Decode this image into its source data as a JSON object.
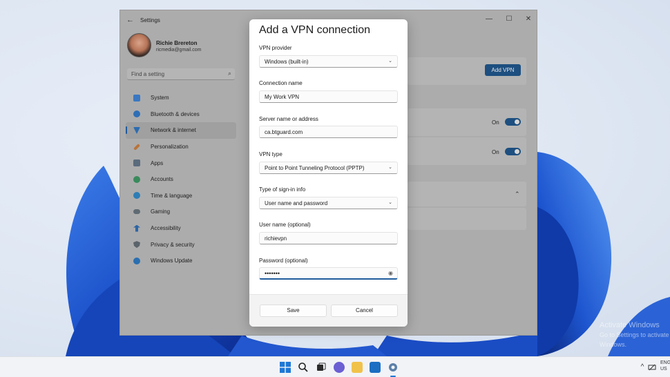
{
  "window": {
    "title": "Settings",
    "back": "←",
    "controls": {
      "minimize": "—",
      "maximize": "☐",
      "close": "✕"
    }
  },
  "user": {
    "name": "Richie Brereton",
    "email": "ricmedia@gmail.com"
  },
  "search": {
    "placeholder": "Find a setting",
    "icon": "⌕"
  },
  "sidebar": {
    "items": [
      {
        "label": "System",
        "color": "#3a78c2"
      },
      {
        "label": "Bluetooth & devices",
        "color": "#2f6fb5"
      },
      {
        "label": "Network & internet",
        "color": "#2c6cb0",
        "active": true
      },
      {
        "label": "Personalization",
        "color": "#b8743a"
      },
      {
        "label": "Apps",
        "color": "#5a6b7c"
      },
      {
        "label": "Accounts",
        "color": "#3a8a5c"
      },
      {
        "label": "Time & language",
        "color": "#2e7db5"
      },
      {
        "label": "Gaming",
        "color": "#5f6a73"
      },
      {
        "label": "Accessibility",
        "color": "#2c65a6"
      },
      {
        "label": "Privacy & security",
        "color": "#5b636b"
      },
      {
        "label": "Windows Update",
        "color": "#2a6fb0"
      }
    ]
  },
  "vpn_page": {
    "add_button": "Add VPN",
    "toggle1_label": "On",
    "toggle2_label": "On",
    "chevron": "⌃"
  },
  "dialog": {
    "title": "Add a VPN connection",
    "provider_label": "VPN provider",
    "provider_value": "Windows (built-in)",
    "conn_name_label": "Connection name",
    "conn_name_value": "My Work VPN",
    "server_label": "Server name or address",
    "server_value": "ca.btguard.com",
    "vpn_type_label": "VPN type",
    "vpn_type_value": "Point to Point Tunneling Protocol (PPTP)",
    "signin_label": "Type of sign-in info",
    "signin_value": "User name and password",
    "username_label": "User name (optional)",
    "username_value": "richievpn",
    "password_label": "Password (optional)",
    "password_value": "•••••••",
    "chevron": "⌄",
    "eye": "◉",
    "save": "Save",
    "cancel": "Cancel"
  },
  "watermark": {
    "line1": "Activate Windows",
    "line2": "Go to Settings to activate Windows."
  },
  "taskbar": {
    "lang1": "ENG",
    "lang2": "US",
    "chevron": "^"
  }
}
